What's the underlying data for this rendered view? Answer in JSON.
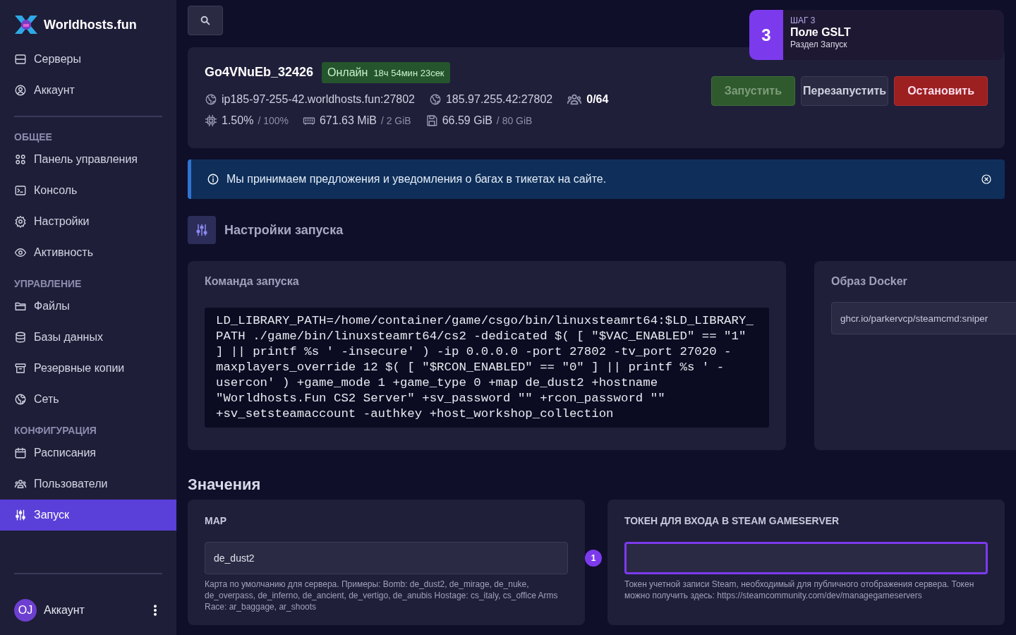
{
  "brand": {
    "name": "Worldhosts.fun"
  },
  "sidebar": {
    "top_items": [
      {
        "label": "Серверы",
        "selected": false
      },
      {
        "label": "Аккаунт",
        "selected": false
      }
    ],
    "sections": [
      {
        "title": "ОБЩЕЕ",
        "items": [
          {
            "label": "Панель управления",
            "selected": false
          },
          {
            "label": "Консоль",
            "selected": false
          },
          {
            "label": "Настройки",
            "selected": false
          },
          {
            "label": "Активность",
            "selected": false
          }
        ]
      },
      {
        "title": "УПРАВЛЕНИЕ",
        "items": [
          {
            "label": "Файлы",
            "selected": false
          },
          {
            "label": "Базы данных",
            "selected": false
          },
          {
            "label": "Резервные копии",
            "selected": false
          },
          {
            "label": "Сеть",
            "selected": false
          }
        ]
      },
      {
        "title": "КОНФИГУРАЦИЯ",
        "items": [
          {
            "label": "Расписания",
            "selected": false
          },
          {
            "label": "Пользователи",
            "selected": false
          },
          {
            "label": "Запуск",
            "selected": true
          }
        ]
      }
    ],
    "account": {
      "initials": "OJ",
      "label": "Аккаунт"
    }
  },
  "server": {
    "name": "Go4VNuEb_32426",
    "status": "Онлайн",
    "uptime": "18ч 54мин 23сек",
    "addresses": [
      "ip185-97-255-42.worldhosts.fun:27802",
      "185.97.255.42:27802"
    ],
    "players": "0/64",
    "stats": [
      {
        "value": "1.50%",
        "limit": "/ 100%"
      },
      {
        "value": "671.63 MiB",
        "limit": "/ 2 GiB"
      },
      {
        "value": "66.59 GiB",
        "limit": "/ 80 GiB"
      }
    ],
    "buttons": [
      {
        "label": "Запустить",
        "kind": "start",
        "disabled": true
      },
      {
        "label": "Перезапустить",
        "kind": "restart",
        "disabled": false
      },
      {
        "label": "Остановить",
        "kind": "stop",
        "disabled": false
      }
    ]
  },
  "tour_step": {
    "number": "3",
    "step": "ШАГ 3",
    "title": "Поле GSLT",
    "subtitle": "Раздел Запуск"
  },
  "notice": {
    "text": "Мы принимаем предложения и уведомления о багах в тикетах на сайте."
  },
  "startup": {
    "title": "Настройки запуска",
    "command_label": "Команда запуска",
    "command": "LD_LIBRARY_PATH=/home/container/game/csgo/bin/linuxsteamrt64:$LD_LIBRARY_PATH ./game/bin/linuxsteamrt64/cs2 -dedicated $( [ \"$VAC_ENABLED\" == \"1\" ] || printf %s ' -insecure' ) -ip 0.0.0.0 -port 27802 -tv_port 27020 -maxplayers_override 12 $( [ \"$RCON_ENABLED\" == \"0\" ] || printf %s ' -usercon' ) +game_mode 1 +game_type 0 +map de_dust2 +hostname \"Worldhosts.Fun CS2 Server\" +sv_password \"\" +rcon_password \"\" +sv_setsteamaccount -authkey +host_workshop_collection",
    "docker_label": "Образ Docker",
    "docker_image": "ghcr.io/parkervcp/steamcmd:sniper"
  },
  "variables": {
    "title": "Значения",
    "fields": [
      {
        "label": "MAP",
        "value": "de_dust2",
        "help": "Карта по умолчанию для сервера. Примеры: Bomb: de_dust2, de_mirage, de_nuke, de_overpass, de_inferno, de_ancient, de_vertigo, de_anubis Hostage: cs_italy, cs_office Arms Race: ar_baggage, ar_shoots",
        "highlighted": false
      },
      {
        "label": "ТОКЕН ДЛЯ ВХОДА В STEAM GAMESERVER",
        "help": "Токен учетной записи Steam, необходимый для публичного отображения сервера. Токен можно получить здесь: https://steamcommunity.com/dev/managegameservers",
        "highlighted": true,
        "marker": "1"
      }
    ]
  }
}
